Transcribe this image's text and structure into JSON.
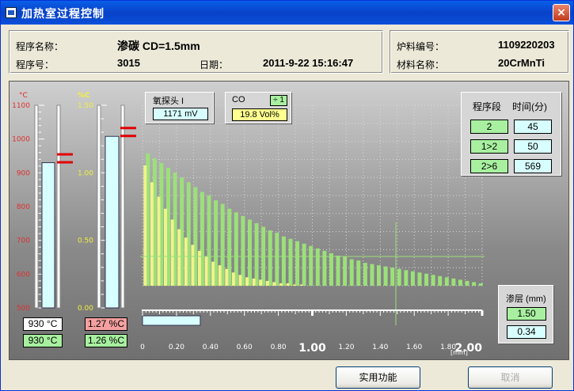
{
  "window": {
    "title": "加热室过程控制",
    "close": "×"
  },
  "info_left": {
    "program_name_label": "程序名称：",
    "program_name_value": "渗碳 CD=1.5mm",
    "program_no_label": "程序号：",
    "program_no_value": "3015",
    "date_label": "日期：",
    "date_value": "2011-9-22 15:16:47"
  },
  "info_right": {
    "furnace_no_label": "炉料编号：",
    "furnace_no_value": "1109220203",
    "material_label": "材料名称：",
    "material_value": "20CrMnTi"
  },
  "temp_gauge": {
    "unit": "°C",
    "ticks": [
      "1100",
      "1000",
      "900",
      "800",
      "700",
      "600",
      "500"
    ],
    "actual_label": "930 °C",
    "setpoint_label": "930 °C",
    "level": 930,
    "min": 500,
    "max": 1100
  },
  "carbon_gauge": {
    "unit": "%C",
    "ticks": [
      "1.50",
      "1.00",
      "0.50",
      "0.00"
    ],
    "actual_label": "1.27 %C",
    "setpoint_label": "1.26 %C",
    "level": 1.27,
    "min": 0,
    "max": 1.5
  },
  "oxygen_probe": {
    "label": "氧探头 I",
    "value": "1171 mV"
  },
  "co": {
    "label": "CO",
    "tag": "÷ 1",
    "value": "19.8 Vol%"
  },
  "program_table": {
    "header_step": "程序段",
    "header_time": "时间(分)",
    "rows": [
      [
        "2",
        "45"
      ],
      [
        "1>2",
        "50"
      ],
      [
        "2>6",
        "569"
      ]
    ]
  },
  "case_depth": {
    "label": "渗层 (mm)",
    "target": "1.50",
    "current": "0.34"
  },
  "x_axis": {
    "ticks": [
      "0.20",
      "0.40",
      "0.60",
      "0.80",
      "1.00",
      "1.20",
      "1.40",
      "1.60",
      "1.80",
      "2.00"
    ],
    "unit": "[mm]",
    "progress": 0.34,
    "min": 0,
    "max": 2
  },
  "buttons": {
    "utility": "实用功能",
    "cancel": "取消"
  },
  "chart_data": {
    "type": "bar",
    "xlabel": "[mm]",
    "xlim": [
      0,
      2
    ],
    "ylim": [
      0,
      1.5
    ],
    "series": [
      {
        "x": [
          0.02,
          0.06,
          0.1,
          0.14,
          0.18,
          0.22,
          0.26,
          0.3,
          0.34,
          0.38,
          0.42,
          0.46,
          0.5,
          0.54,
          0.58,
          0.62,
          0.66,
          0.7,
          0.74,
          0.78,
          0.82,
          0.86,
          0.9,
          0.94,
          0.98,
          1.02,
          1.06,
          1.1,
          1.14,
          1.18,
          1.22,
          1.26,
          1.3,
          1.34,
          1.38,
          1.42,
          1.46,
          1.5,
          1.54,
          1.58,
          1.62,
          1.66,
          1.7,
          1.74,
          1.78,
          1.82,
          1.86,
          1.9,
          1.94,
          1.98
        ],
        "values": [
          1.1,
          1.06,
          1.02,
          0.98,
          0.94,
          0.9,
          0.86,
          0.82,
          0.78,
          0.75,
          0.71,
          0.68,
          0.64,
          0.61,
          0.58,
          0.55,
          0.52,
          0.49,
          0.46,
          0.44,
          0.41,
          0.39,
          0.37,
          0.35,
          0.33,
          0.31,
          0.29,
          0.27,
          0.25,
          0.24,
          0.22,
          0.21,
          0.19,
          0.18,
          0.17,
          0.16,
          0.15,
          0.14,
          0.13,
          0.12,
          0.11,
          0.1,
          0.09,
          0.08,
          0.07,
          0.06,
          0.05,
          0.04,
          0.03,
          0.02
        ],
        "color": "#9CE07A"
      },
      {
        "x": [
          0.02,
          0.06,
          0.1,
          0.14,
          0.18,
          0.22,
          0.26,
          0.3,
          0.34,
          0.38,
          0.42,
          0.46,
          0.5,
          0.54,
          0.58,
          0.62,
          0.66,
          0.7,
          0.74,
          0.78,
          0.82,
          0.86,
          0.9,
          0.94
        ],
        "values": [
          1.0,
          0.86,
          0.74,
          0.64,
          0.55,
          0.47,
          0.4,
          0.34,
          0.29,
          0.24,
          0.2,
          0.17,
          0.14,
          0.11,
          0.09,
          0.07,
          0.06,
          0.05,
          0.04,
          0.03,
          0.02,
          0.02,
          0.01,
          0.01
        ],
        "color": "#F2F28C"
      }
    ]
  },
  "colors": {
    "temp_bar": "#D8FFFF",
    "carbon_bar": "#D8FFFF",
    "green_box": "#A8F0A0",
    "pink_box": "#F4A0A0",
    "yellow_box": "#FFFF90",
    "marker": "#E00000"
  }
}
